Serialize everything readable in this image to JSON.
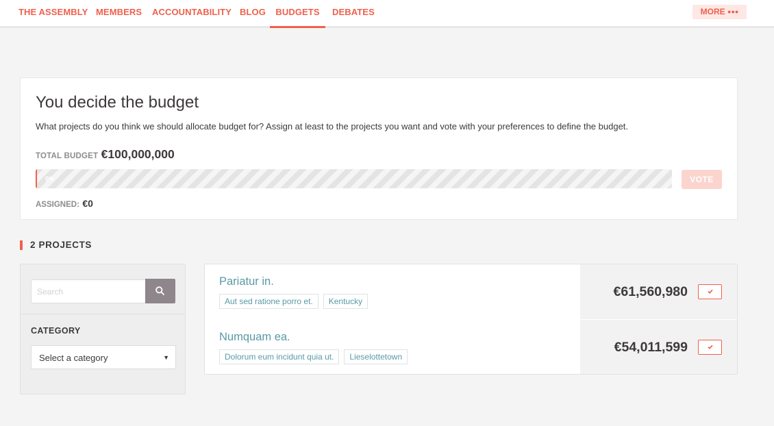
{
  "nav": {
    "items": [
      {
        "label": "THE ASSEMBLY",
        "active": false
      },
      {
        "label": "MEMBERS",
        "active": false
      },
      {
        "label": "ACCOUNTABILITY",
        "active": false
      },
      {
        "label": "BLOG",
        "active": false
      },
      {
        "label": "BUDGETS",
        "active": true
      },
      {
        "label": "DEBATES",
        "active": false
      }
    ],
    "more_label": "MORE",
    "more_dots": "●●●"
  },
  "budget": {
    "title": "You decide the budget",
    "description": "What projects do you think we should allocate budget for? Assign at least to the projects you want and vote with your preferences to define the budget.",
    "total_label": "TOTAL BUDGET",
    "total_value": "€100,000,000",
    "progress_percent": 0,
    "progress_text": "0%",
    "vote_label": "VOTE",
    "assigned_label": "ASSIGNED:",
    "assigned_value": "€0"
  },
  "projects_heading": "2 PROJECTS",
  "filters": {
    "search_placeholder": "Search",
    "category_label": "CATEGORY",
    "category_select": "Select a category"
  },
  "projects": [
    {
      "title": "Pariatur in.",
      "tags": [
        "Aut sed ratione porro et.",
        "Kentucky"
      ],
      "amount": "€61,560,980"
    },
    {
      "title": "Numquam ea.",
      "tags": [
        "Dolorum eum incidunt quia ut.",
        "Lieselottetown"
      ],
      "amount": "€54,011,599"
    }
  ],
  "colors": {
    "accent": "#ef604d",
    "link": "#599aa6",
    "text": "#3d393c",
    "background": "#f4f4f4"
  },
  "icons": {
    "search_button": "search-icon",
    "add_button": "check-icon"
  }
}
